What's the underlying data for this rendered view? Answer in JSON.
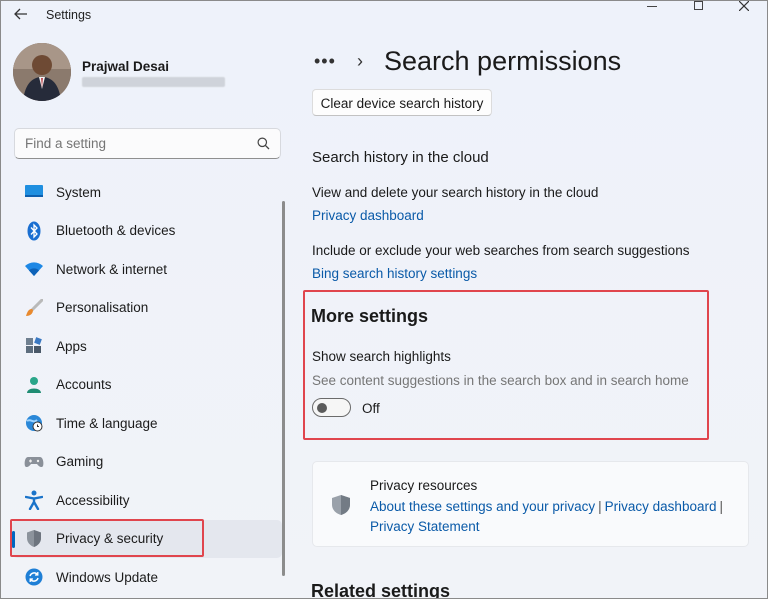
{
  "window": {
    "title": "Settings"
  },
  "profile": {
    "name": "Prajwal Desai"
  },
  "search": {
    "placeholder": "Find a setting"
  },
  "sidebar": {
    "items": [
      {
        "label": "System",
        "icon": "monitor-icon"
      },
      {
        "label": "Bluetooth & devices",
        "icon": "bluetooth-icon"
      },
      {
        "label": "Network & internet",
        "icon": "wifi-icon"
      },
      {
        "label": "Personalisation",
        "icon": "brush-icon"
      },
      {
        "label": "Apps",
        "icon": "apps-icon"
      },
      {
        "label": "Accounts",
        "icon": "person-icon"
      },
      {
        "label": "Time & language",
        "icon": "globe-clock-icon"
      },
      {
        "label": "Gaming",
        "icon": "gamepad-icon"
      },
      {
        "label": "Accessibility",
        "icon": "accessibility-icon"
      },
      {
        "label": "Privacy & security",
        "icon": "shield-icon",
        "selected": true
      },
      {
        "label": "Windows Update",
        "icon": "update-icon"
      }
    ]
  },
  "main": {
    "breadcrumb_ellipsis": "•••",
    "breadcrumb_chevron": "›",
    "title": "Search permissions",
    "clear_button": "Clear device search history",
    "cloud": {
      "heading": "Search history in the cloud",
      "view_text": "View and delete your search history in the cloud",
      "privacy_dashboard_link": "Privacy dashboard",
      "include_text": "Include or exclude your web searches from search suggestions",
      "bing_link": "Bing search history settings"
    },
    "more_settings": {
      "heading": "More settings",
      "highlights_label": "Show search highlights",
      "highlights_desc": "See content suggestions in the search box and in search home",
      "toggle_state": "Off"
    },
    "privacy_resources": {
      "title": "Privacy resources",
      "link1": "About these settings and your privacy",
      "link2": "Privacy dashboard",
      "link3": "Privacy Statement",
      "separator": "|"
    },
    "related_heading": "Related settings"
  },
  "colors": {
    "accent": "#0067c0",
    "link": "#0a5aa8",
    "highlight_box": "#e0454d"
  }
}
